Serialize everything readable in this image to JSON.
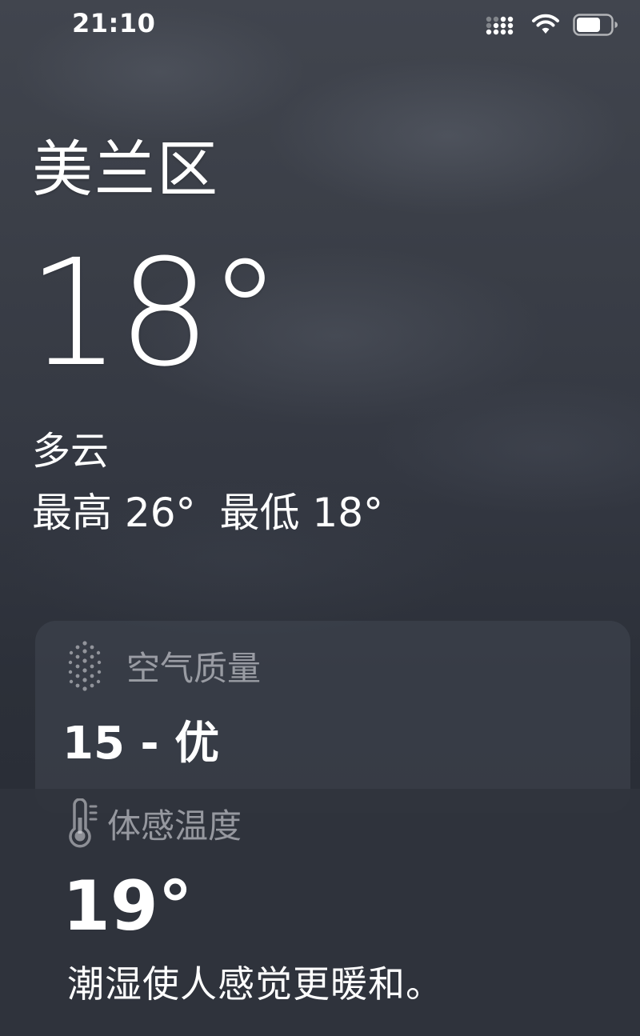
{
  "status_bar": {
    "time": "21:10",
    "cellular_icon": "cellular-signal-icon",
    "wifi_icon": "wifi-icon",
    "battery_icon": "battery-icon"
  },
  "weather": {
    "location": "美兰区",
    "current_temp": "18°",
    "condition": "多云",
    "high": "最高 26°",
    "low": "最低 18°"
  },
  "air_quality": {
    "icon": "air-quality-dots-icon",
    "title": "空气质量",
    "value": "15 - 优"
  },
  "feels_like": {
    "icon": "thermometer-icon",
    "title": "体感温度",
    "value": "19°",
    "description": "潮湿使人感觉更暖和。"
  }
}
